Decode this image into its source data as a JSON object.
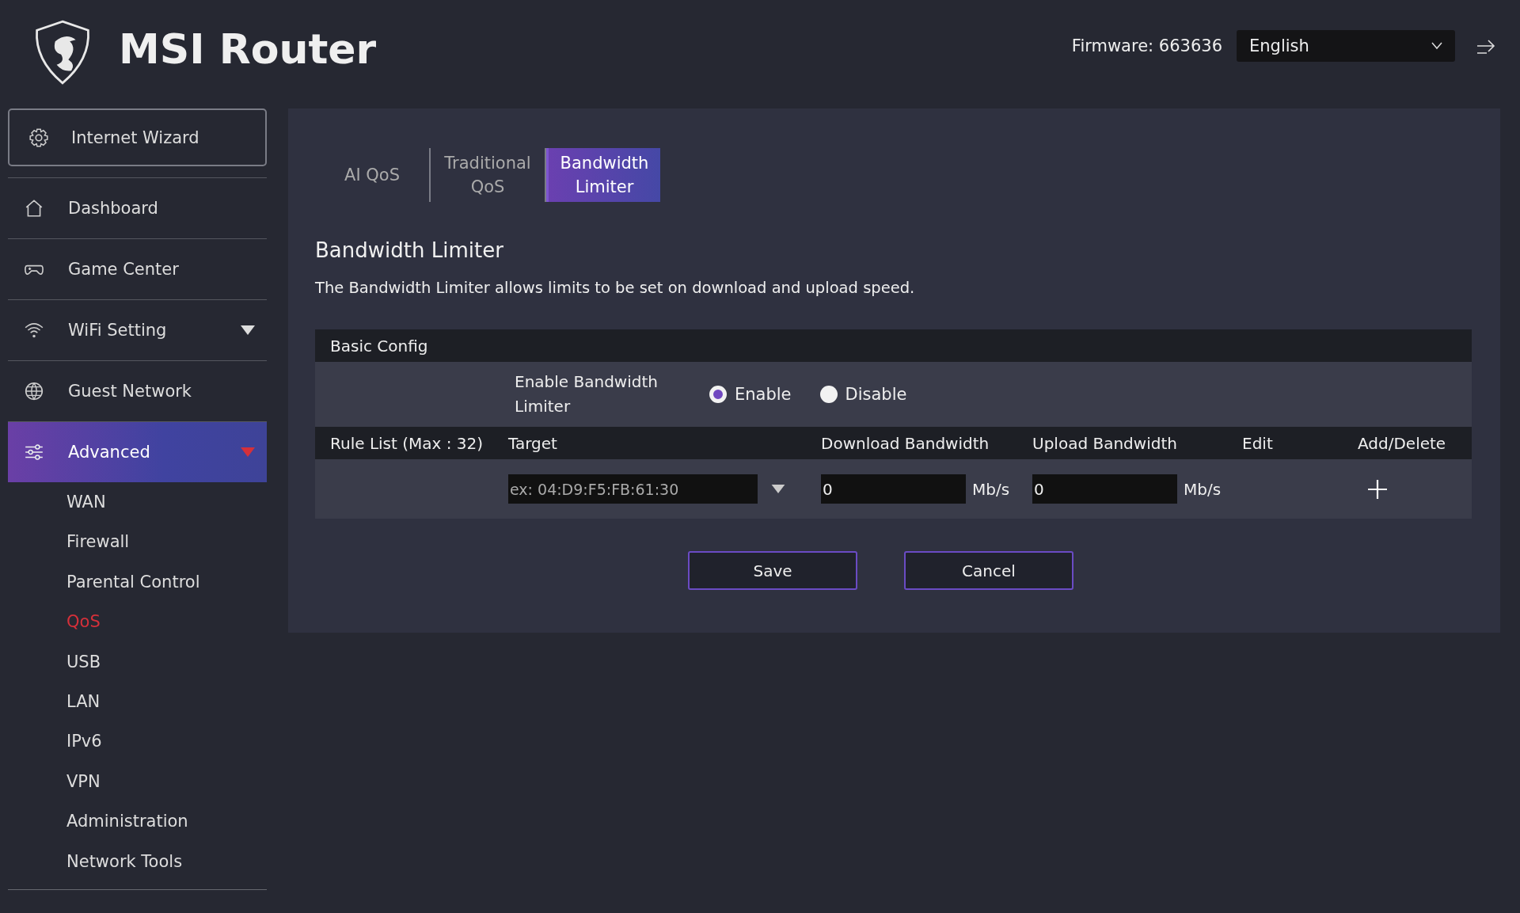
{
  "header": {
    "title": "MSI Router",
    "firmware": "Firmware: 663636",
    "language": "English"
  },
  "sidebar": {
    "wizard": {
      "label": "Internet Wizard"
    },
    "items": [
      {
        "label": "Dashboard",
        "selected": false
      },
      {
        "label": "Game Center",
        "selected": false
      },
      {
        "label": "WiFi Setting",
        "selected": false,
        "expanded": false
      },
      {
        "label": "Guest Network",
        "selected": false
      },
      {
        "label": "Advanced",
        "selected": true,
        "expanded": true,
        "children": [
          {
            "label": "WAN",
            "selected": false
          },
          {
            "label": "Firewall",
            "selected": false
          },
          {
            "label": "Parental Control",
            "selected": false
          },
          {
            "label": "QoS",
            "selected": true
          },
          {
            "label": "USB",
            "selected": false
          },
          {
            "label": "LAN",
            "selected": false
          },
          {
            "label": "IPv6",
            "selected": false
          },
          {
            "label": "VPN",
            "selected": false
          },
          {
            "label": "Administration",
            "selected": false
          },
          {
            "label": "Network Tools",
            "selected": false
          }
        ]
      }
    ]
  },
  "tabs": [
    {
      "label": "AI QoS",
      "selected": false
    },
    {
      "label": "Traditional QoS",
      "selected": false
    },
    {
      "label": "Bandwidth Limiter",
      "selected": true
    }
  ],
  "section": {
    "title": "Bandwidth Limiter",
    "description": "The Bandwidth Limiter allows limits to be set on download and upload speed."
  },
  "basic_config": {
    "header": "Basic Config",
    "label": "Enable Bandwidth Limiter",
    "options": [
      {
        "label": "Enable",
        "selected": true
      },
      {
        "label": "Disable",
        "selected": false
      }
    ]
  },
  "rule_list": {
    "columns": [
      "Rule List (Max : 32)",
      "Target",
      "Download Bandwidth",
      "Upload Bandwidth",
      "Edit",
      "Add/Delete"
    ],
    "row": {
      "target_placeholder": "ex: 04:D9:F5:FB:61:30",
      "download": "0",
      "download_unit": "Mb/s",
      "upload": "0",
      "upload_unit": "Mb/s"
    }
  },
  "buttons": [
    "Save",
    "Cancel"
  ]
}
